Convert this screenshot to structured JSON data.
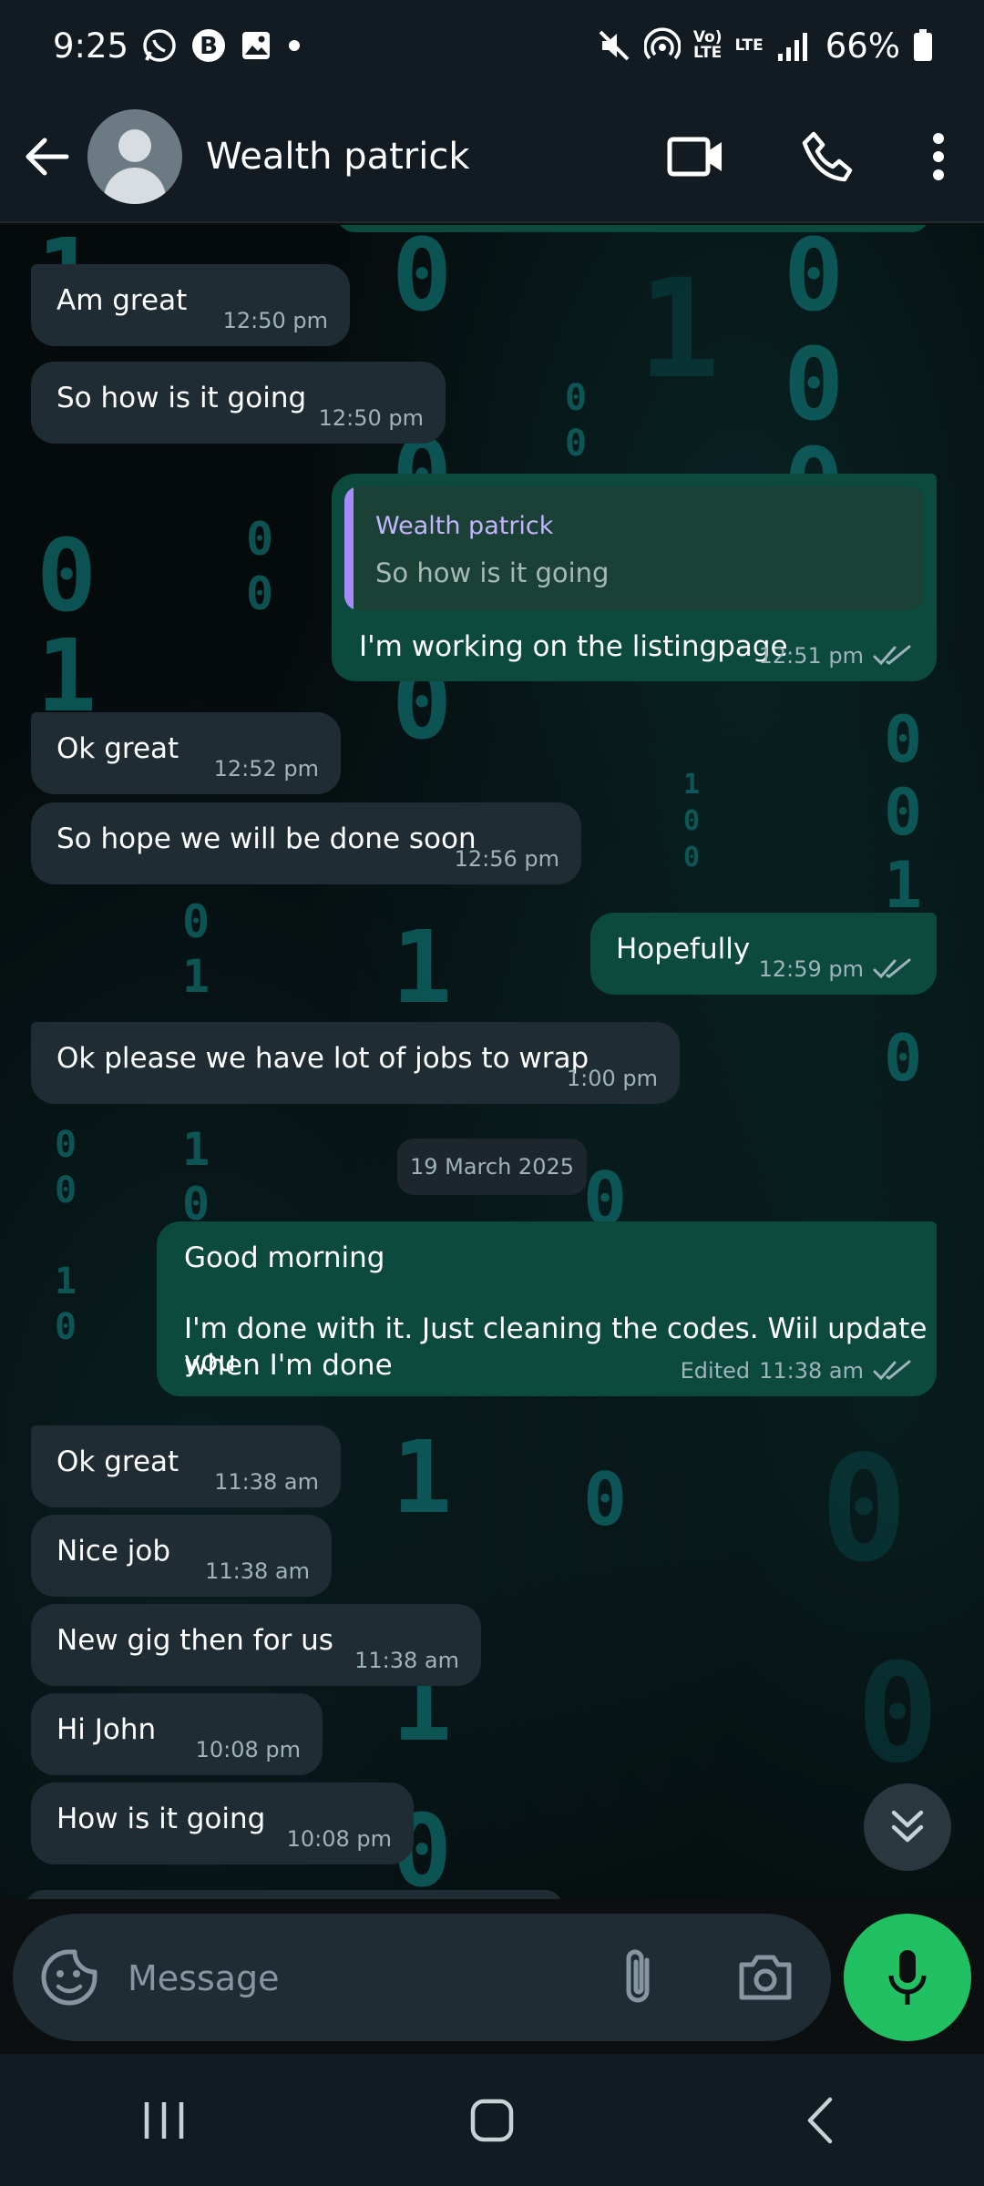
{
  "status_bar": {
    "time": "9:25",
    "battery": "66%",
    "network_volte": "Vo)\nLTE",
    "network_lte": "LTE"
  },
  "header": {
    "contact_name": "Wealth patrick"
  },
  "date_separator": "19 March 2025",
  "messages": [
    {
      "dir": "in",
      "text": "Am great",
      "time": "12:50 pm"
    },
    {
      "dir": "in",
      "text": "So how is it going",
      "time": "12:50 pm"
    },
    {
      "dir": "out",
      "quote_author": "Wealth patrick",
      "quote_text": "So how is it going",
      "text": "I'm working on the listingpage",
      "time": "12:51 pm"
    },
    {
      "dir": "in",
      "text": "Ok great",
      "time": "12:52 pm"
    },
    {
      "dir": "in",
      "text": "So hope we will be done soon",
      "time": "12:56 pm"
    },
    {
      "dir": "out",
      "text": "Hopefully",
      "time": "12:59 pm"
    },
    {
      "dir": "in",
      "text": "Ok please we have lot of jobs to wrap",
      "time": "1:00 pm"
    },
    {
      "dir": "out",
      "text_line1": "Good morning",
      "text_line2": "I'm done with it. Just cleaning the codes. Wiil update you",
      "text_line3": "when I'm done",
      "edited": "Edited",
      "time": "11:38 am"
    },
    {
      "dir": "in",
      "text": "Ok great",
      "time": "11:38 am"
    },
    {
      "dir": "in",
      "text": "Nice job",
      "time": "11:38 am"
    },
    {
      "dir": "in",
      "text": "New gig then for us",
      "time": "11:38 am"
    },
    {
      "dir": "in",
      "text": "Hi John",
      "time": "10:08 pm"
    },
    {
      "dir": "in",
      "text": "How is it going",
      "time": "10:08 pm"
    }
  ],
  "composer": {
    "placeholder": "Message"
  },
  "icons": {
    "accent_green": "#21c063",
    "outgoing_bubble": "#0b4a3c",
    "incoming_bubble": "#1f2c34"
  }
}
